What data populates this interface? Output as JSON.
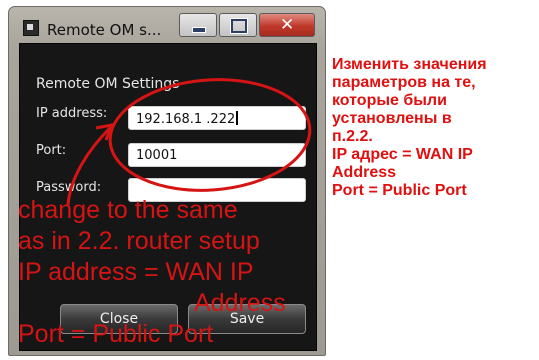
{
  "window": {
    "title": "Remote OM s..."
  },
  "dialog": {
    "heading": "Remote OM Settings",
    "ip_label": "IP address:",
    "ip_value": "192.168.1 .222",
    "port_label": "Port:",
    "port_value": "10001",
    "password_label": "Password:",
    "password_value": "",
    "close_button": "Close",
    "save_button": "Save"
  },
  "annotations": {
    "overlay_lines": [
      "change to the same",
      "as in 2.2. router setup",
      "IP address = WAN IP",
      "Address",
      "Port = Public Port"
    ],
    "right_note_lines": [
      "Изменить значения",
      "параметров на те,",
      "которые были",
      "установлены в",
      "п.2.2.",
      "IP адрес = WAN IP",
      "Address",
      "Port = Public Port"
    ]
  },
  "colors": {
    "annotation_red": "#d61414",
    "client_background": "#161616"
  },
  "icons": {
    "app": "window-app-icon",
    "minimize": "minimize-icon",
    "maximize": "maximize-icon",
    "close": "close-icon"
  }
}
